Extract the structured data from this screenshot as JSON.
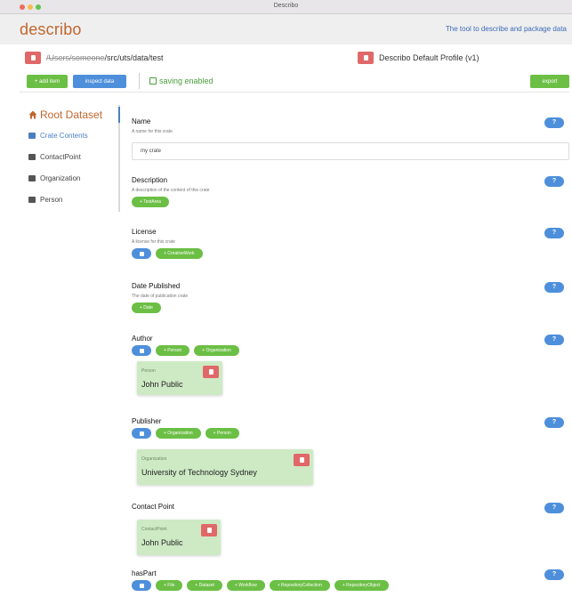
{
  "window": {
    "title": "Describo"
  },
  "header": {
    "logo": "describo",
    "tagline": "The tool to describe and package data"
  },
  "path_bar": {
    "path_hidden": "/Users/someone",
    "path_visible": "/src/uts/data/test",
    "profile": "Describo Default Profile (v1)"
  },
  "toolbar": {
    "add_item": "+ add item",
    "inspect_data": "inspect data",
    "saving": "saving enabled",
    "export": "export"
  },
  "sidebar": {
    "root": "Root Dataset",
    "items": [
      {
        "label": "Crate Contents",
        "icon": "folder-icon"
      },
      {
        "label": "ContactPoint",
        "icon": "id-card-icon"
      },
      {
        "label": "Organization",
        "icon": "building-icon"
      },
      {
        "label": "Person",
        "icon": "user-icon"
      }
    ]
  },
  "fields": {
    "name": {
      "label": "Name",
      "help": "A name for this crate",
      "value": "my crate"
    },
    "description": {
      "label": "Description",
      "help": "A description of the content of this crate",
      "buttons": [
        "+ TextArea"
      ]
    },
    "license": {
      "label": "License",
      "help": "A license for this crate",
      "buttons": [
        "+ CreativeWork"
      ]
    },
    "date_published": {
      "label": "Date Published",
      "help": "The date of publication crate",
      "buttons": [
        "+ Date"
      ]
    },
    "author": {
      "label": "Author",
      "buttons": [
        "+ Person",
        "+ Organization"
      ],
      "entity": {
        "type": "Person",
        "name": "John Public"
      }
    },
    "publisher": {
      "label": "Publisher",
      "buttons": [
        "+ Organization",
        "+ Person"
      ],
      "entity": {
        "type": "Organization",
        "name": "University of Technology Sydney"
      }
    },
    "contact_point": {
      "label": "Contact Point",
      "entity": {
        "type": "ContactPoint",
        "name": "John Public"
      }
    },
    "has_part": {
      "label": "hasPart",
      "buttons": [
        "+ File",
        "+ Dataset",
        "+ Workflow",
        "+ RepositoryCollection",
        "+ RepositoryObject"
      ]
    }
  },
  "info_label": "?",
  "colors": {
    "brand": "#c2662d",
    "green": "#6cbf45",
    "blue": "#4e8fdb",
    "delete": "#e06868",
    "card": "#cdeac4"
  }
}
